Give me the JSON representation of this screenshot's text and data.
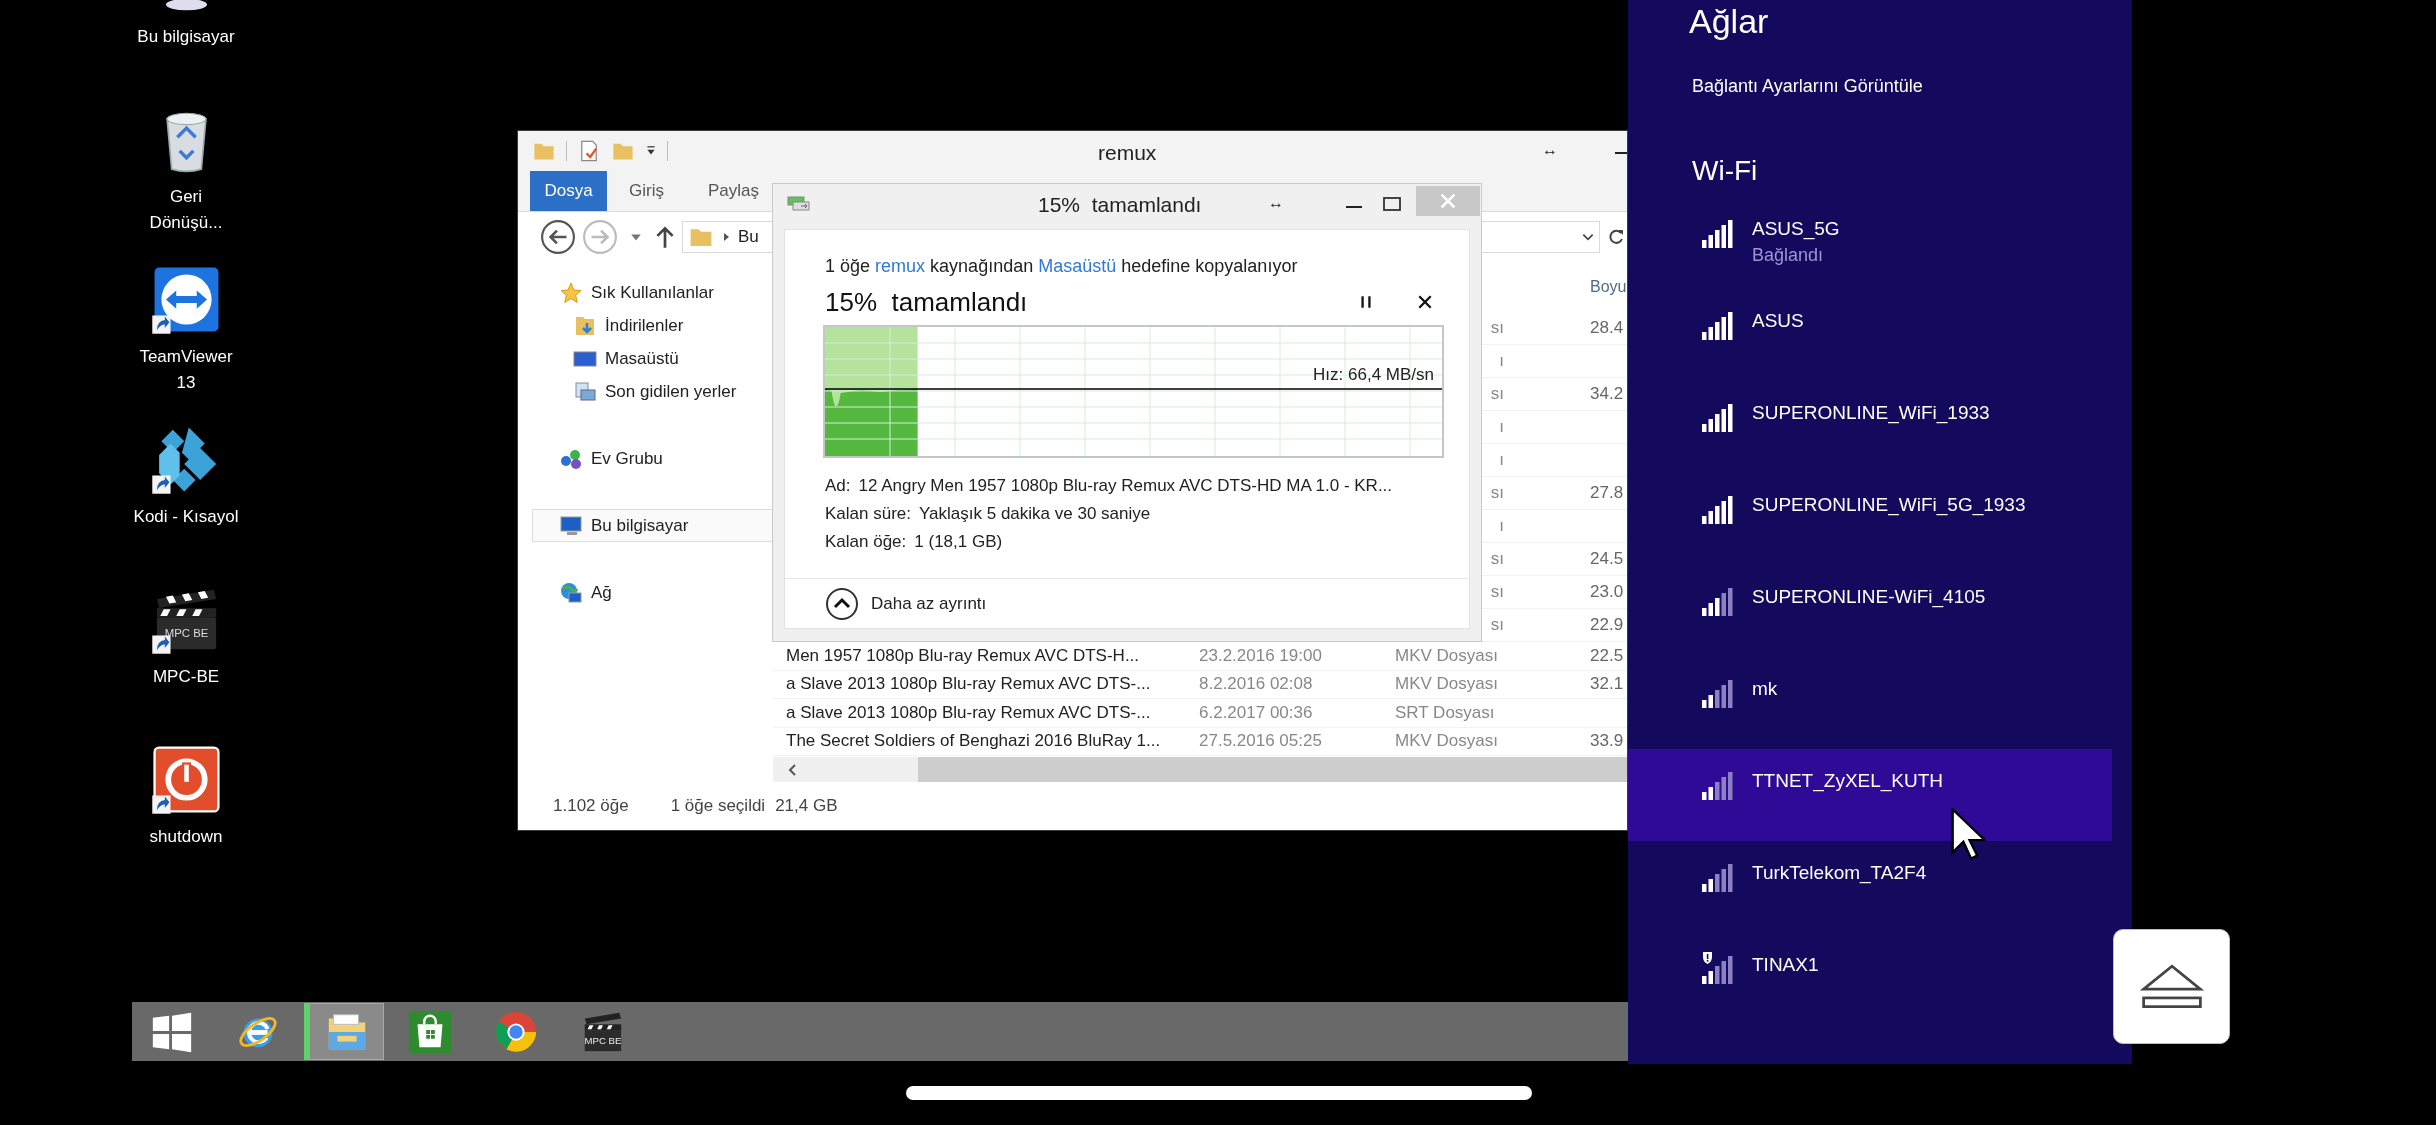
{
  "desktop_icons": [
    {
      "label": "Bu bilgisayar",
      "kind": "computer",
      "shortcut": false
    },
    {
      "label": "Geri\nDönüşü...",
      "kind": "recycle",
      "shortcut": false
    },
    {
      "label": "TeamViewer\n13",
      "kind": "teamviewer",
      "shortcut": true
    },
    {
      "label": "Kodi - Kısayol",
      "kind": "kodi",
      "shortcut": true
    },
    {
      "label": "MPC-BE",
      "kind": "mpc",
      "shortcut": true,
      "logo_text": "MPC BE"
    },
    {
      "label": "shutdown",
      "kind": "power",
      "shortcut": true
    }
  ],
  "explorer": {
    "title": "remux",
    "resize_glyph": "↔",
    "ribbon_tabs": [
      {
        "label": "Dosya",
        "selected": true
      },
      {
        "label": "Giriş",
        "selected": false
      },
      {
        "label": "Paylaş",
        "selected": false
      }
    ],
    "address": "Bu",
    "nav_items": [
      {
        "label": "Sık Kullanılanlar",
        "kind": "favorites",
        "selected": false,
        "children": [
          {
            "label": "İndirilenler",
            "kind": "downloads",
            "selected": false
          },
          {
            "label": "Masaüstü",
            "kind": "desktop",
            "selected": false
          },
          {
            "label": "Son gidilen yerler",
            "kind": "recent",
            "selected": false
          }
        ]
      },
      {
        "label": "Ev Grubu",
        "kind": "homegroup",
        "selected": false
      },
      {
        "label": "Bu bilgisayar",
        "kind": "computer",
        "selected": true
      },
      {
        "label": "Ağ",
        "kind": "network",
        "selected": false
      }
    ],
    "column_4_header": "Boyu",
    "rows": [
      {
        "kind": "covered",
        "type": "sı",
        "size": "28.4"
      },
      {
        "kind": "covered",
        "type": "ı"
      },
      {
        "kind": "covered",
        "type": "sı",
        "size": "34.2"
      },
      {
        "kind": "covered",
        "type": "ı"
      },
      {
        "kind": "covered",
        "type": "ı"
      },
      {
        "kind": "covered",
        "type": "sı",
        "size": "27.8"
      },
      {
        "kind": "covered",
        "type": "ı"
      },
      {
        "kind": "covered",
        "type": "sı",
        "size": "24.5"
      },
      {
        "kind": "covered",
        "type": "sı",
        "size": "23.0"
      },
      {
        "kind": "covered",
        "type": "sı",
        "size": "22.9"
      },
      {
        "kind": "full",
        "name": "Men 1957 1080p Blu-ray Remux AVC DTS-H...",
        "date": "23.2.2016 19:00",
        "type": "MKV Dosyası",
        "size": "22.5"
      },
      {
        "kind": "full",
        "name": "a Slave 2013 1080p Blu-ray Remux AVC DTS-...",
        "date": "8.2.2016 02:08",
        "type": "MKV Dosyası",
        "size": "32.1"
      },
      {
        "kind": "full",
        "name": "a Slave 2013 1080p Blu-ray Remux AVC DTS-...",
        "date": "6.2.2017 00:36",
        "type": "SRT Dosyası"
      },
      {
        "kind": "full",
        "name": "The Secret Soldiers of Benghazi 2016 BluRay 1...",
        "date": "27.5.2016 05:25",
        "type": "MKV Dosyası",
        "size": "33.9"
      }
    ],
    "status": [
      "1.102 öğe",
      "1 öğe seçildi",
      "21,4 GB"
    ]
  },
  "copy_dialog": {
    "title": "15%  tamamlandı",
    "resize_glyph": "↔",
    "summary": [
      {
        "text": "1 öğe",
        "kind": "text"
      },
      {
        "text": "remux",
        "kind": "link"
      },
      {
        "text": "kaynağından",
        "kind": "text"
      },
      {
        "text": "Masaüstü",
        "kind": "link"
      },
      {
        "text": "hedefine kopyalanıyor",
        "kind": "text"
      }
    ],
    "heading": "15%  tamamlandı",
    "progress": {
      "level": 0.15
    },
    "speed": "Hız: 66,4 MB/sn",
    "details": [
      {
        "label": "Ad:",
        "value": "12 Angry Men 1957 1080p Blu-ray Remux AVC DTS-HD MA 1.0 - KR..."
      },
      {
        "label": "Kalan süre:",
        "value": "Yaklaşık 5 dakika ve 30 saniye"
      },
      {
        "label": "Kalan öğe:",
        "value": "1 (18,1 GB)"
      }
    ],
    "toggle": "Daha az ayrıntı"
  },
  "networks_panel": {
    "title": "Ağlar",
    "settings_link": "Bağlantı Ayarlarını Görüntüle",
    "section": "Wi-Fi",
    "networks": [
      {
        "name": "ASUS_5G",
        "status": "Bağlandı",
        "kind": "strong",
        "warning": false,
        "selected": false
      },
      {
        "name": "ASUS",
        "kind": "strong",
        "warning": false,
        "selected": false
      },
      {
        "name": "SUPERONLINE_WiFi_1933",
        "kind": "strong",
        "warning": false,
        "selected": false
      },
      {
        "name": "SUPERONLINE_WiFi_5G_1933",
        "kind": "strong",
        "warning": false,
        "selected": false
      },
      {
        "name": "SUPERONLINE-WiFi_4105",
        "kind": "medium",
        "warning": false,
        "selected": false
      },
      {
        "name": "mk",
        "kind": "weak",
        "warning": false,
        "selected": false
      },
      {
        "name": "TTNET_ZyXEL_KUTH",
        "kind": "weak",
        "warning": false,
        "selected": true
      },
      {
        "name": "TurkTelekom_TA2F4",
        "kind": "weak",
        "warning": false,
        "selected": false
      },
      {
        "name": "TINAX1",
        "kind": "weak",
        "warning": true,
        "selected": false
      }
    ]
  },
  "taskbar": {
    "items": [
      {
        "kind": "start",
        "selected": false
      },
      {
        "kind": "ie",
        "selected": false
      },
      {
        "kind": "explorer",
        "selected": true
      },
      {
        "kind": "store",
        "selected": false
      },
      {
        "kind": "chrome",
        "selected": false
      },
      {
        "kind": "mpc",
        "selected": false,
        "logo_text": "MPC BE"
      }
    ]
  }
}
